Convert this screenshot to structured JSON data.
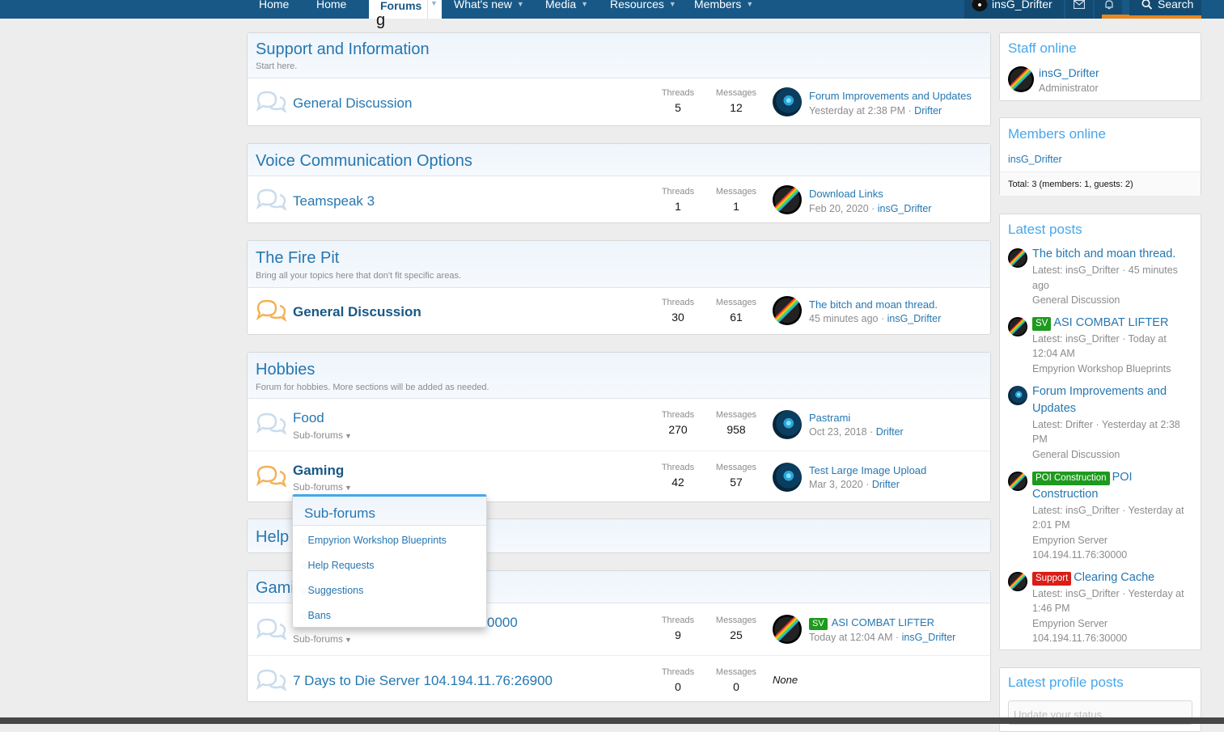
{
  "nav": {
    "tabs": [
      "Home",
      "Home",
      "What's new",
      "Media",
      "Resources",
      "Members"
    ],
    "active_tab": "Forums",
    "account_name": "insG_Drifter",
    "search_label": "Search"
  },
  "page": {
    "title_fragment": "g"
  },
  "stat_labels": {
    "threads": "Threads",
    "messages": "Messages"
  },
  "categories": {
    "support": {
      "title": "Support and Information",
      "desc": "Start here.",
      "forums": [
        {
          "name": "General Discussion",
          "threads": "5",
          "messages": "12",
          "last_title": "Forum Improvements and Updates",
          "last_time": "Yesterday at 2:38 PM",
          "last_user": "Drifter"
        }
      ]
    },
    "voice": {
      "title": "Voice Communication Options",
      "forums": [
        {
          "name": "Teamspeak 3",
          "threads": "1",
          "messages": "1",
          "last_title": "Download Links",
          "last_time": "Feb 20, 2020",
          "last_user": "insG_Drifter"
        }
      ]
    },
    "firepit": {
      "title": "The Fire Pit",
      "desc": "Bring all your topics here that don't fit specific areas.",
      "forums": [
        {
          "name": "General Discussion",
          "threads": "30",
          "messages": "61",
          "last_title": "The bitch and moan thread.",
          "last_time": "45 minutes ago",
          "last_user": "insG_Drifter"
        }
      ]
    },
    "hobbies": {
      "title": "Hobbies",
      "desc": "Forum for hobbies. More sections will be added as needed.",
      "forums": [
        {
          "name": "Food",
          "subforums": "Sub-forums",
          "threads": "270",
          "messages": "958",
          "last_title": "Pastrami",
          "last_time": "Oct 23, 2018",
          "last_user": "Drifter"
        },
        {
          "name": "Gaming",
          "subforums": "Sub-forums",
          "threads": "42",
          "messages": "57",
          "last_title": "Test Large Image Upload",
          "last_time": "Mar 3, 2020",
          "last_user": "Drifter"
        }
      ]
    },
    "help": {
      "title": "Help"
    },
    "gaming": {
      "title": "Gami",
      "forums": [
        {
          "name_fragment": "0000",
          "subforums": "Sub-forums",
          "threads": "9",
          "messages": "25",
          "last_prefix": "SV",
          "last_title": "ASI COMBAT LIFTER",
          "last_time": "Today at 12:04 AM",
          "last_user": "insG_Drifter"
        },
        {
          "name": "7 Days to Die Server 104.194.11.76:26900",
          "threads": "0",
          "messages": "0",
          "last_none": "None"
        }
      ]
    }
  },
  "popup": {
    "title": "Sub-forums",
    "items": [
      "Empyrion Workshop Blueprints",
      "Help Requests",
      "Suggestions",
      "Bans"
    ]
  },
  "sidebar": {
    "staff": {
      "title": "Staff online",
      "name": "insG_Drifter",
      "role": "Administrator"
    },
    "members": {
      "title": "Members online",
      "name": "insG_Drifter",
      "total": "Total: 3 (members: 1, guests: 2)"
    },
    "latest": {
      "title": "Latest posts",
      "posts": [
        {
          "title": "The bitch and moan thread.",
          "meta1": "Latest: insG_Drifter · 45 minutes",
          "meta2": "ago",
          "forum": "General Discussion"
        },
        {
          "prefix": "SV",
          "title": "ASI COMBAT LIFTER",
          "meta1": "Latest: insG_Drifter · Today at",
          "meta2": "12:04 AM",
          "forum": "Empyrion Workshop Blueprints"
        },
        {
          "title1": "Forum Improvements and",
          "title2": "Updates",
          "meta1": "Latest: Drifter · Yesterday at 2:38",
          "meta2": "PM",
          "forum": "General Discussion"
        },
        {
          "prefix": "POI Construction",
          "title1": "POI",
          "title2": "Construction",
          "meta1": "Latest: insG_Drifter · Yesterday at",
          "meta2": "2:01 PM",
          "forum": "Empyrion Server",
          "forum2": "104.194.11.76:30000"
        },
        {
          "prefix": "Support",
          "title": "Clearing Cache",
          "meta1": "Latest: insG_Drifter · Yesterday at",
          "meta2": "1:46 PM",
          "forum": "Empyrion Server",
          "forum2": "104.194.11.76:30000"
        }
      ]
    },
    "profile": {
      "title": "Latest profile posts",
      "placeholder": "Update your status..."
    }
  },
  "colors": {
    "nav": "#185886",
    "link": "#2577b1",
    "accent": "#47a7eb",
    "orange": "#e9861c",
    "prefix_green": "#1e9a1e",
    "prefix_red": "#d91e18"
  }
}
